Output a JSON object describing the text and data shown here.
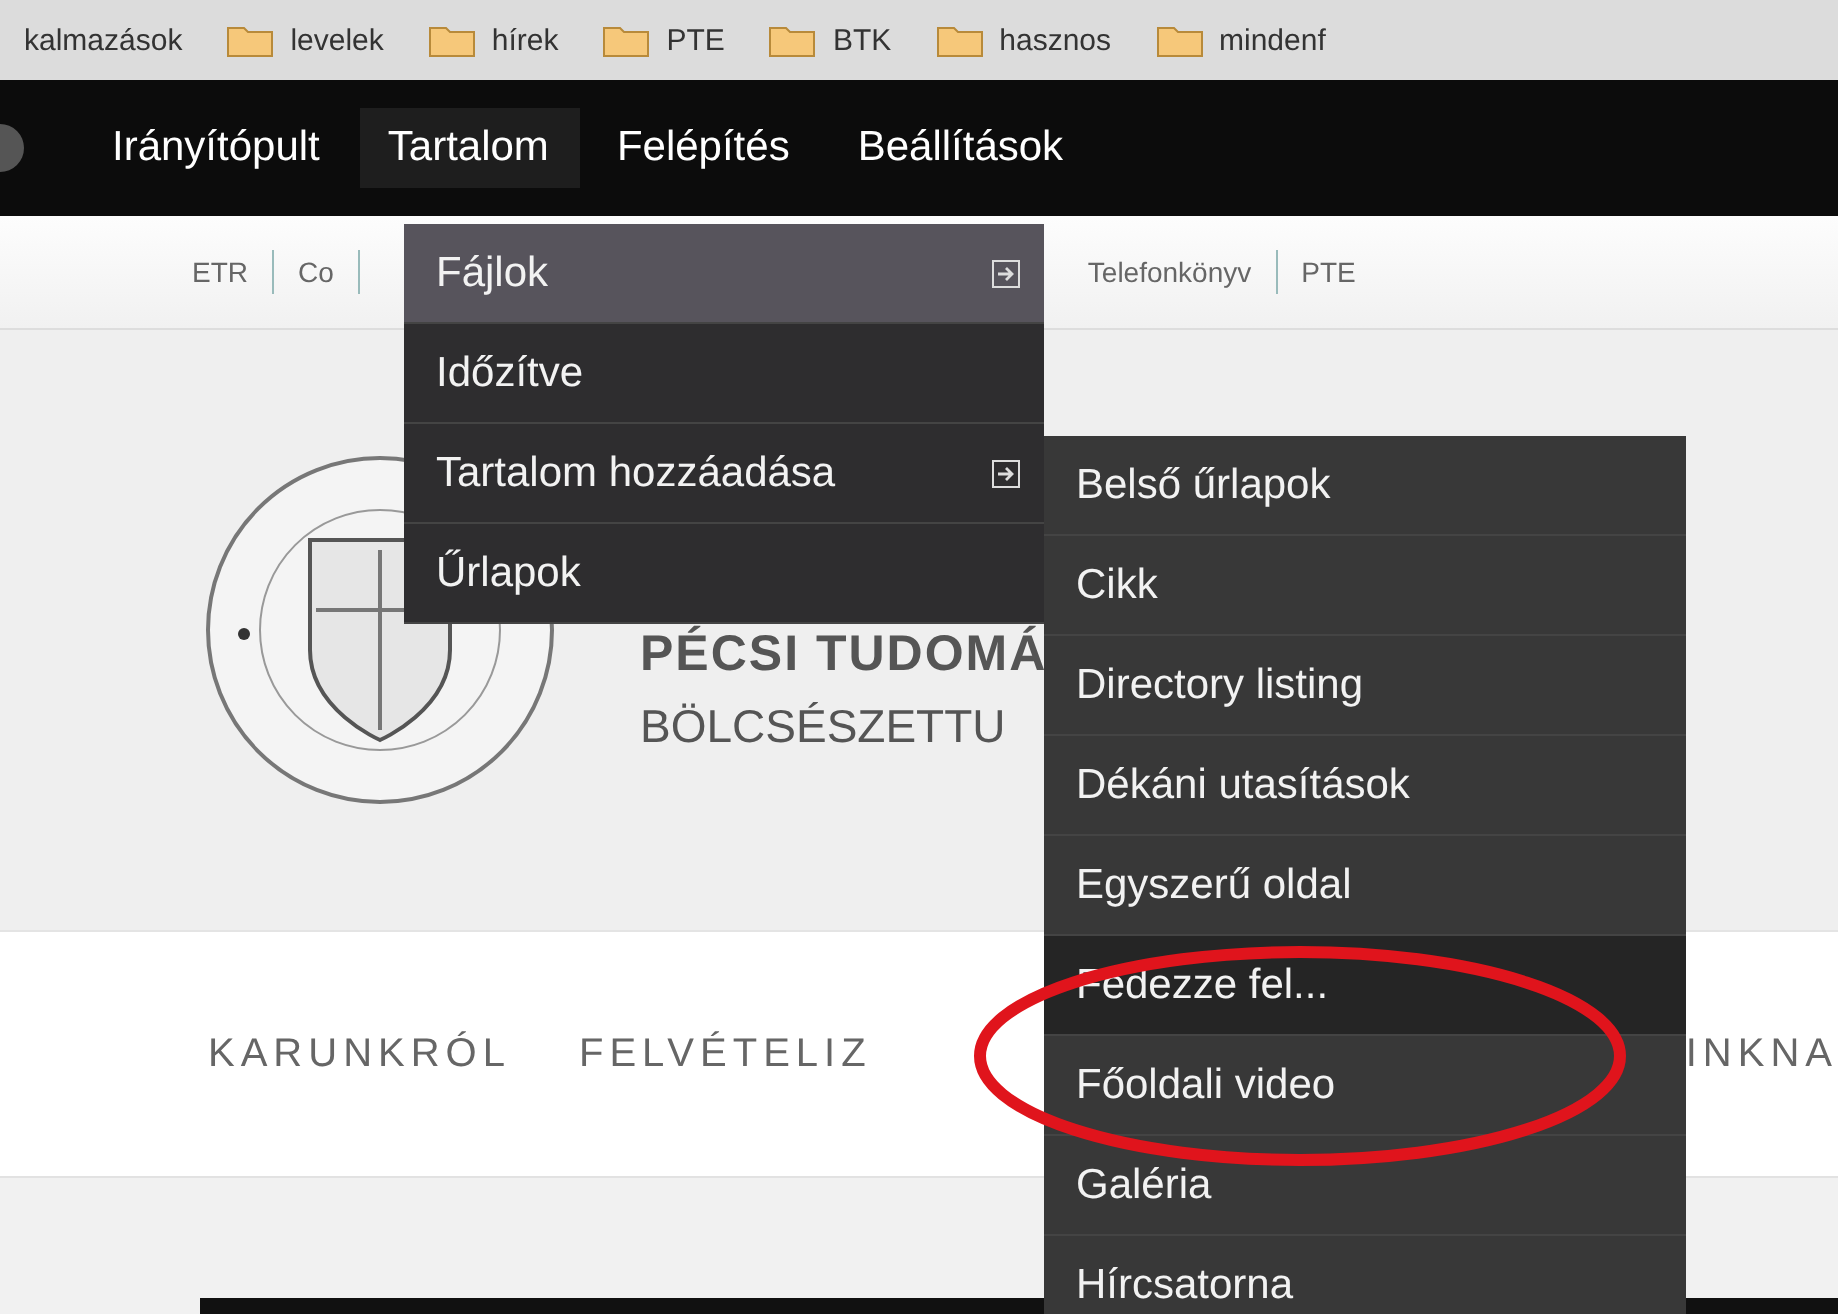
{
  "bookmarks": [
    {
      "label": "kalmazások",
      "folder": false
    },
    {
      "label": "levelek",
      "folder": true
    },
    {
      "label": "hírek",
      "folder": true
    },
    {
      "label": "PTE",
      "folder": true
    },
    {
      "label": "BTK",
      "folder": true
    },
    {
      "label": "hasznos",
      "folder": true
    },
    {
      "label": "mindenf",
      "folder": true
    }
  ],
  "toolbar": {
    "items": [
      {
        "label": "Irányítópult",
        "selected": false
      },
      {
        "label": "Tartalom",
        "selected": true
      },
      {
        "label": "Felépítés",
        "selected": false
      },
      {
        "label": "Beállítások",
        "selected": false
      }
    ]
  },
  "utility_links": [
    "ETR",
    "Co",
    "Telefonkönyv",
    "PTE"
  ],
  "site_title": "PÉCSI TUDOMÁ",
  "site_subtitle": "BÖLCSÉSZETTU",
  "nav": [
    "KARUNKRÓL",
    "FELVÉTELIZ",
    "INKNA"
  ],
  "dropdown": [
    {
      "label": "Fájlok",
      "selected": true,
      "has_submenu": true
    },
    {
      "label": "Időzítve",
      "selected": false,
      "has_submenu": false
    },
    {
      "label": "Tartalom hozzáadása",
      "selected": false,
      "has_submenu": true
    },
    {
      "label": "Űrlapok",
      "selected": false,
      "has_submenu": false
    }
  ],
  "submenu": [
    {
      "label": "Belső űrlapok",
      "selected": false
    },
    {
      "label": "Cikk",
      "selected": false
    },
    {
      "label": "Directory listing",
      "selected": false
    },
    {
      "label": "Dékáni utasítások",
      "selected": false
    },
    {
      "label": "Egyszerű oldal",
      "selected": false
    },
    {
      "label": "Fedezze fel...",
      "selected": true
    },
    {
      "label": "Főoldali video",
      "selected": false
    },
    {
      "label": "Galéria",
      "selected": false
    },
    {
      "label": "Hírcsatorna",
      "selected": false
    }
  ]
}
